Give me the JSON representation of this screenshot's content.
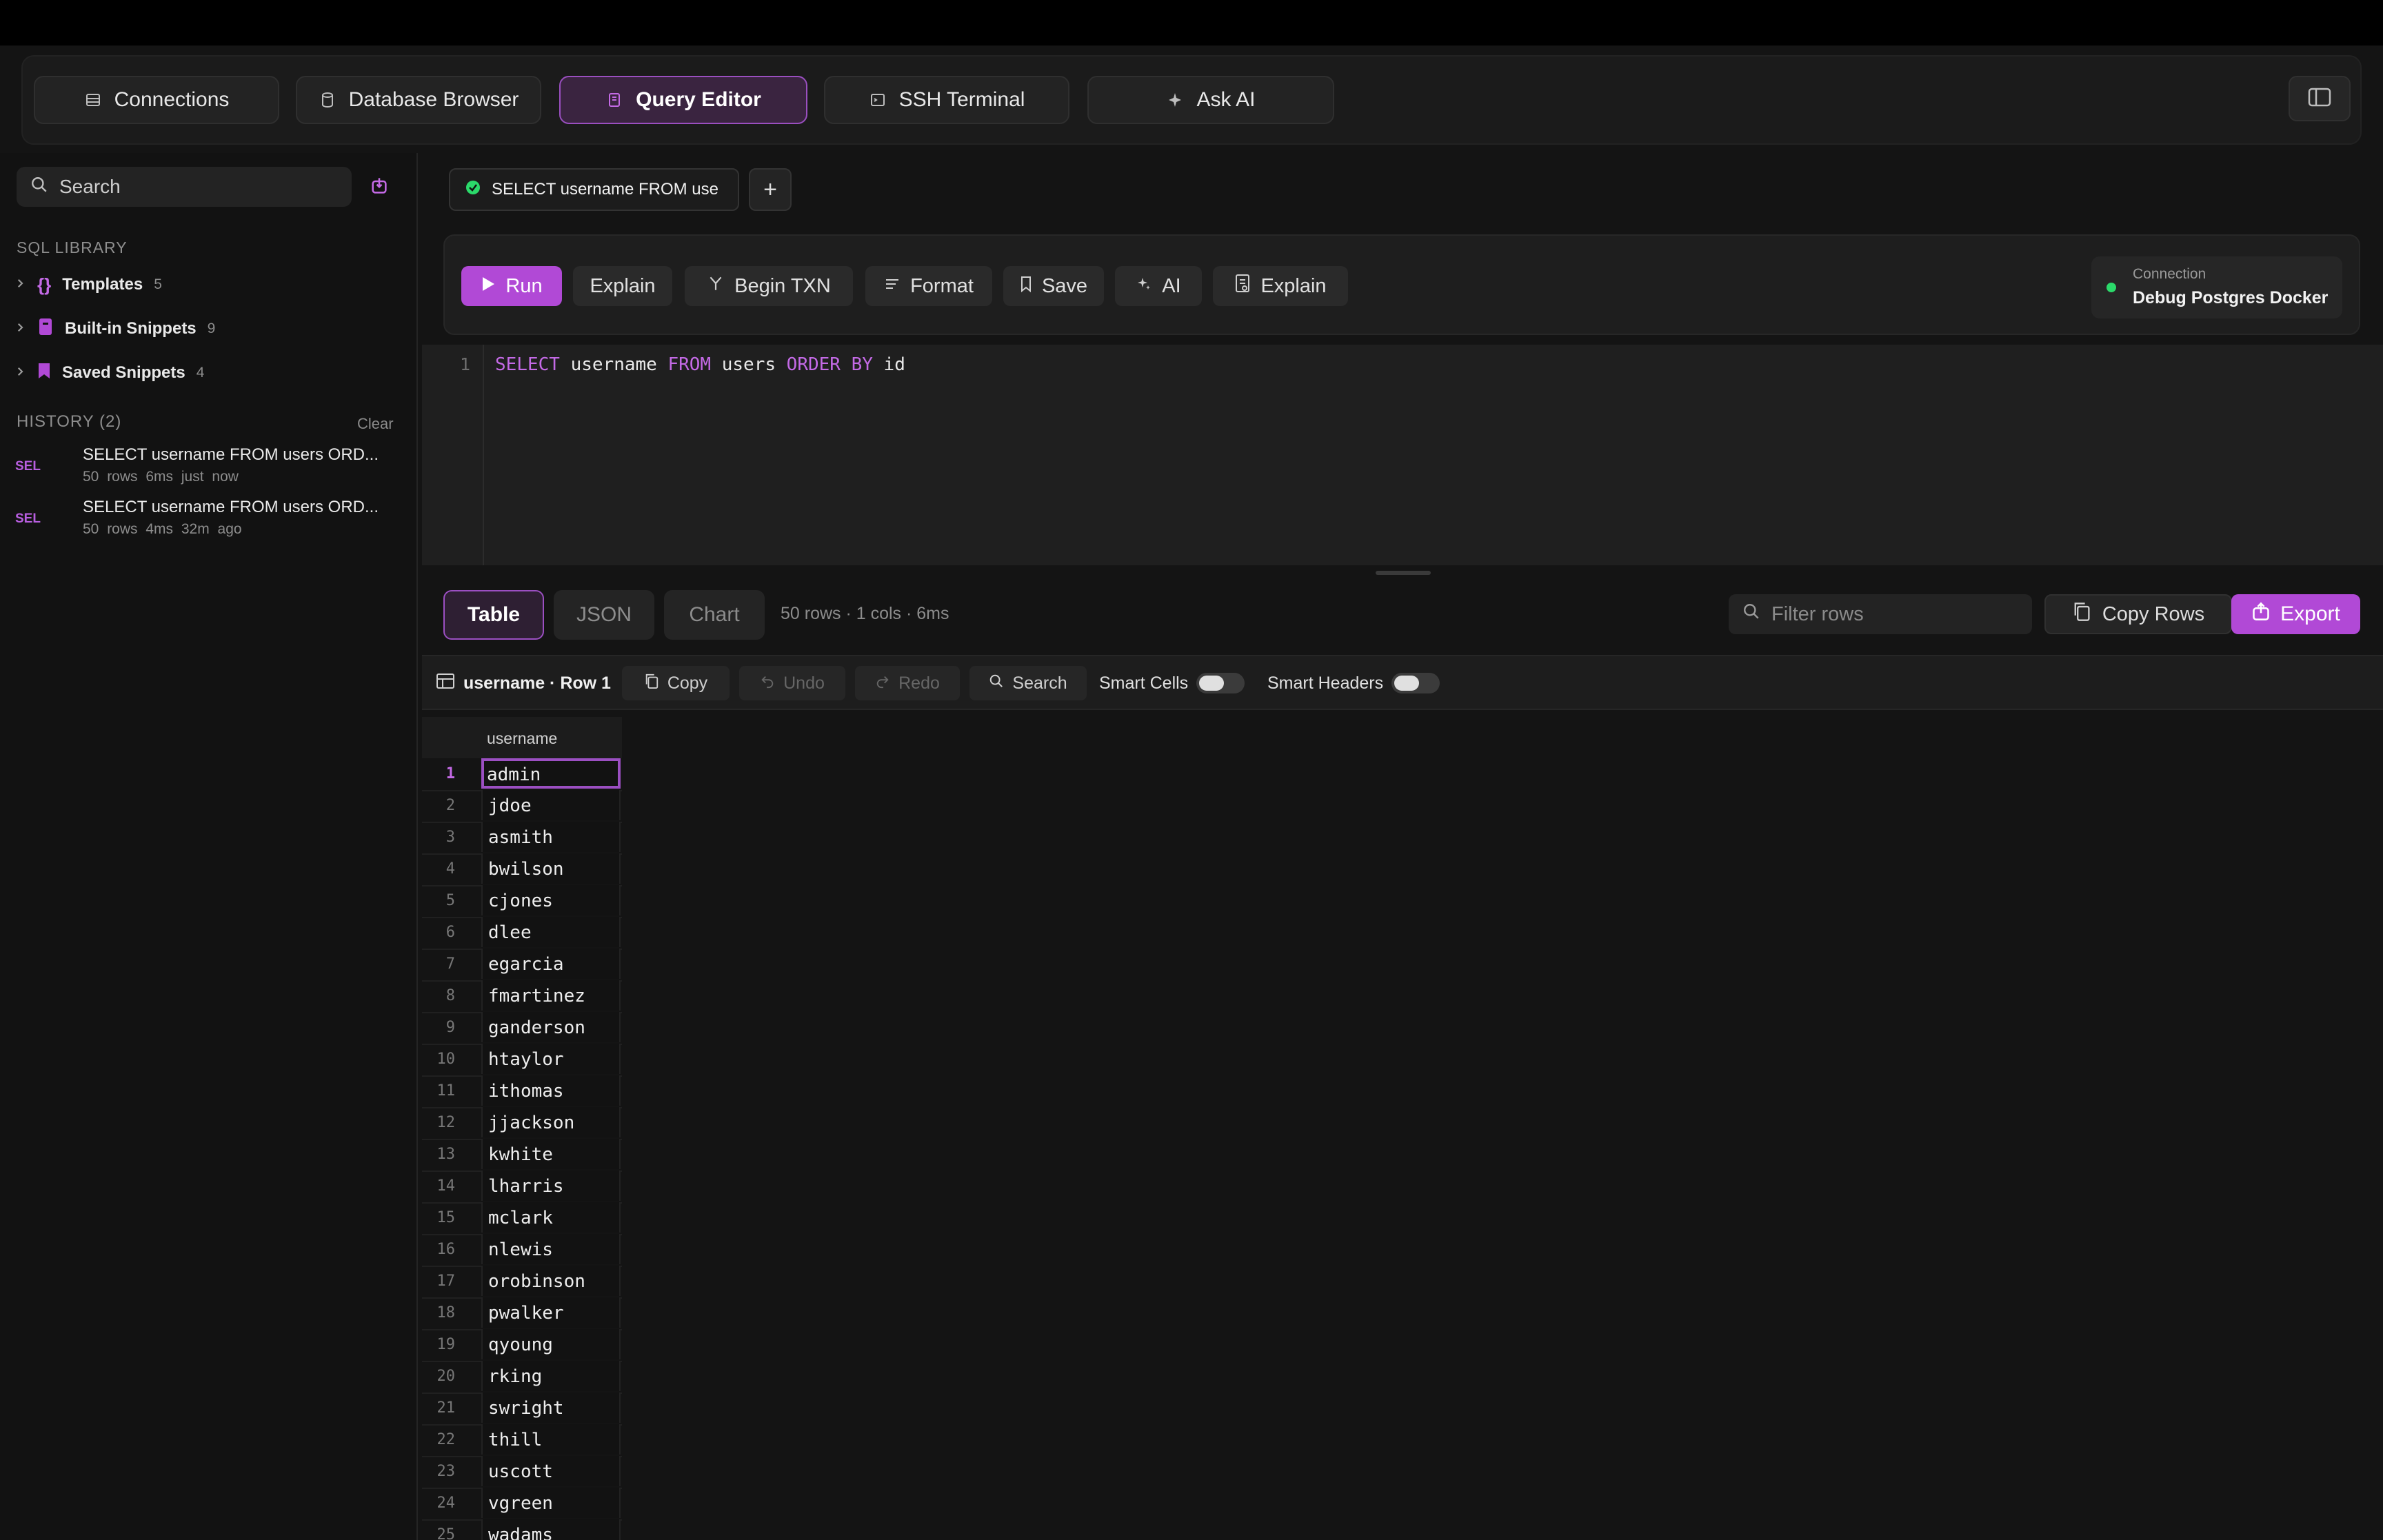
{
  "colors": {
    "accent": "#b149d6",
    "success": "#2bd96a",
    "keyword": "#c46ae6"
  },
  "tabs": [
    {
      "label": "Connections",
      "icon": "server-icon"
    },
    {
      "label": "Database Browser",
      "icon": "database-icon"
    },
    {
      "label": "Query Editor",
      "icon": "document-icon",
      "active": true
    },
    {
      "label": "SSH Terminal",
      "icon": "terminal-icon"
    },
    {
      "label": "Ask AI",
      "icon": "sparkle-icon"
    }
  ],
  "sidebar": {
    "search_placeholder": "Search",
    "library_title": "SQL LIBRARY",
    "library": [
      {
        "label": "Templates",
        "count": "5",
        "icon": "braces-icon"
      },
      {
        "label": "Built-in Snippets",
        "count": "9",
        "icon": "snippet-icon"
      },
      {
        "label": "Saved Snippets",
        "count": "4",
        "icon": "bookmark-icon"
      }
    ],
    "history_title": "HISTORY (2)",
    "history_clear": "Clear",
    "history": [
      {
        "badge": "SEL",
        "query": "SELECT username FROM users ORD...",
        "meta": "50 rows  6ms  just now"
      },
      {
        "badge": "SEL",
        "query": "SELECT username FROM users ORD...",
        "meta": "50 rows  4ms  32m ago"
      }
    ]
  },
  "query_tab": {
    "label": "SELECT username FROM use",
    "add": "+"
  },
  "toolbar": {
    "run": "Run",
    "explain": "Explain",
    "begin_txn": "Begin TXN",
    "format": "Format",
    "save": "Save",
    "ai": "AI",
    "explain2": "Explain",
    "connection_label": "Connection",
    "connection_name": "Debug Postgres Docker"
  },
  "editor": {
    "line": "1",
    "sql_tokens": [
      "SELECT",
      " username ",
      "FROM",
      " users ",
      "ORDER BY",
      " id"
    ]
  },
  "results": {
    "tabs": [
      "Table",
      "JSON",
      "Chart"
    ],
    "meta": "50 rows · 1 cols · 6ms",
    "filter_placeholder": "Filter rows",
    "copy_rows": "Copy Rows",
    "export": "Export"
  },
  "gridbar": {
    "selection": "username · Row 1",
    "copy": "Copy",
    "undo": "Undo",
    "redo": "Redo",
    "search": "Search",
    "smart_cells": "Smart Cells",
    "smart_headers": "Smart Headers"
  },
  "grid": {
    "column": "username",
    "rows": [
      "admin",
      "jdoe",
      "asmith",
      "bwilson",
      "cjones",
      "dlee",
      "egarcia",
      "fmartinez",
      "ganderson",
      "htaylor",
      "ithomas",
      "jjackson",
      "kwhite",
      "lharris",
      "mclark",
      "nlewis",
      "orobinson",
      "pwalker",
      "qyoung",
      "rking",
      "swright",
      "thill",
      "uscott",
      "vgreen",
      "wadams"
    ]
  }
}
